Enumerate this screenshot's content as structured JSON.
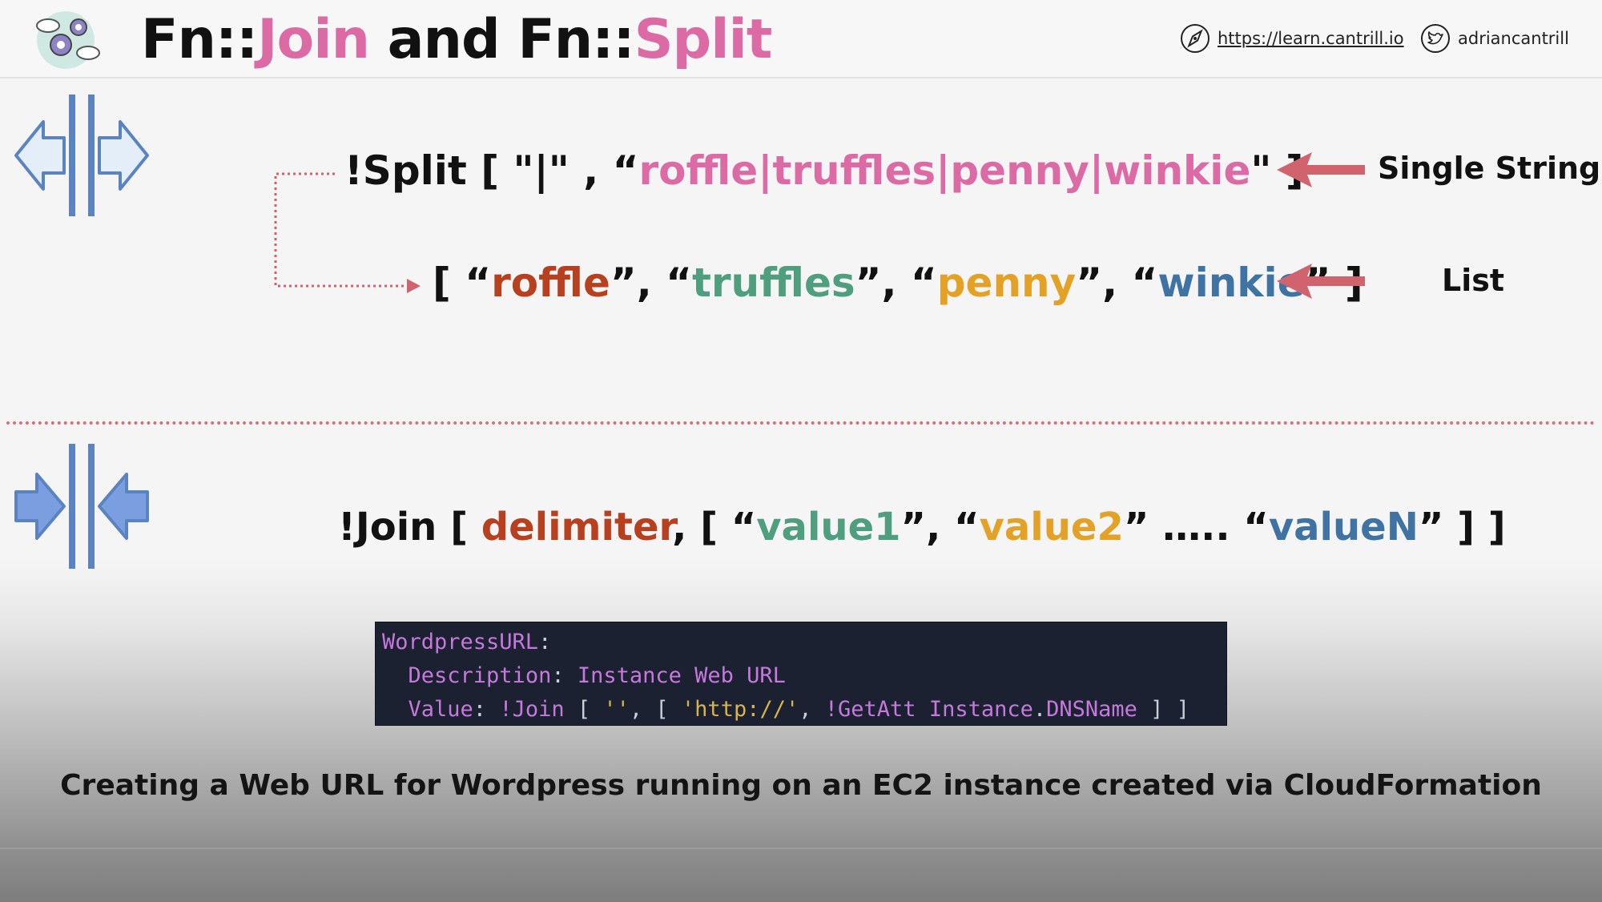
{
  "header": {
    "title_part1": "Fn::",
    "title_part2": "Join",
    "title_part3": " and Fn::",
    "title_part4": "Split",
    "website": "https://learn.cantrill.io",
    "twitter": "adriancantrill"
  },
  "split_example": {
    "prefix": "!Split [ \"|\" , “",
    "string": "roffle|truffles|penny|winkie",
    "suffix": "\" ]",
    "arrow_label": "Single String"
  },
  "list_example": {
    "open": "[ “",
    "item1": "roffle",
    "sep1": "”, “",
    "item2": "truffles",
    "sep2": "”, “",
    "item3": "penny",
    "sep3": "”, “",
    "item4": "winkie",
    "close": "” ]",
    "arrow_label": "List"
  },
  "join_example": {
    "prefix": "!Join [ ",
    "delimiter": "delimiter",
    "sep0": ", [ “",
    "value1": "value1",
    "sep1": "”, “",
    "value2": "value2",
    "sep2": "” ….. “",
    "valueN": "valueN",
    "close": "” ] ]"
  },
  "code": {
    "line1_key": "WordpressURL",
    "line1_colon": ":",
    "line2_indent": "  ",
    "line2_key": "Description",
    "line2_colon": ": ",
    "line2_value": "Instance Web URL",
    "line3_indent": "  ",
    "line3_key": "Value",
    "line3_colon": ": ",
    "line3_fn": "!Join",
    "line3_p1": " [ ",
    "line3_s1": "''",
    "line3_p2": ", [ ",
    "line3_s2": "'http://'",
    "line3_p3": ", ",
    "line3_fn2": "!GetAtt",
    "line3_p4": " ",
    "line3_attr1": "Instance",
    "line3_p5": ".",
    "line3_attr2": "DNSName",
    "line3_p6": " ] ]"
  },
  "caption": "Creating a Web URL for Wordpress running on an EC2 instance created via CloudFormation",
  "colors": {
    "pink": "#db6aa5",
    "red": "#b8401f",
    "green": "#4e9e7f",
    "orange": "#e3a125",
    "blue": "#3e73a3",
    "arrow": "#d0636e",
    "icon_blue": "#5b83c0"
  },
  "icons": {
    "logo": "gears-clouds-logo",
    "website": "compass-icon",
    "twitter": "twitter-bird-icon",
    "split": "split-arrows-icon",
    "join": "join-arrows-icon"
  }
}
